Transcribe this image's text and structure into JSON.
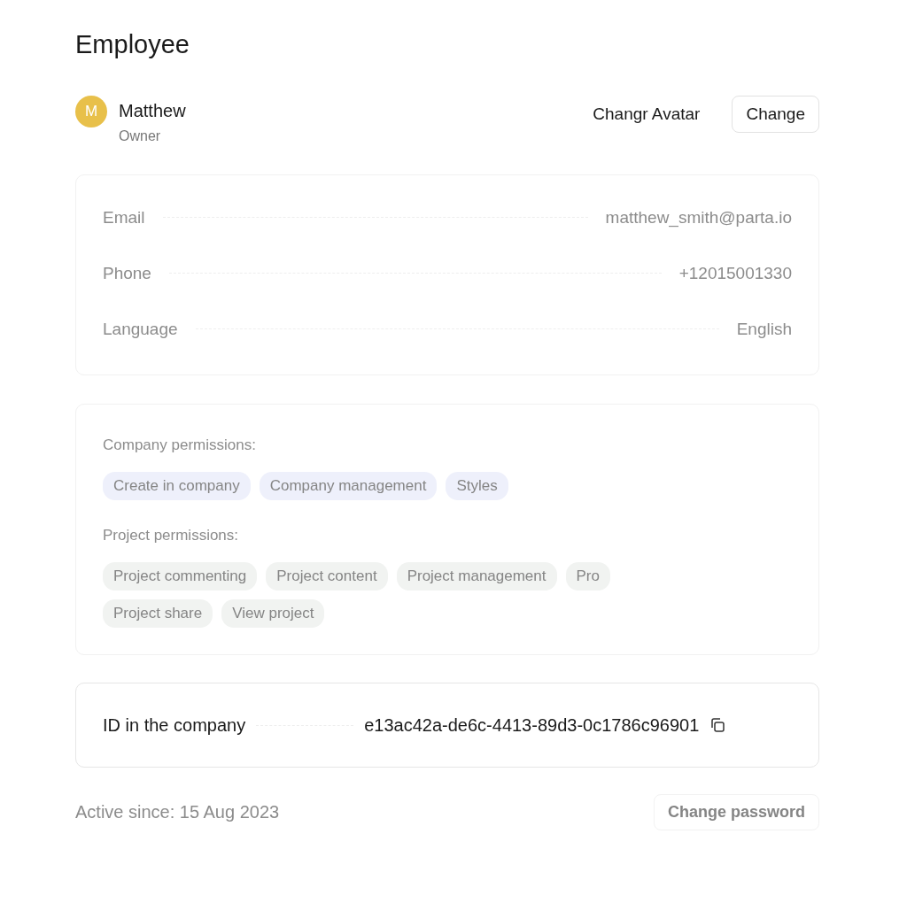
{
  "title": "Employee",
  "user": {
    "initial": "M",
    "name": "Matthew",
    "role": "Owner"
  },
  "avatar": {
    "label": "Changr Avatar",
    "button": "Change"
  },
  "contacts": [
    {
      "label": "Email",
      "value": "matthew_smith@parta.io"
    },
    {
      "label": "Phone",
      "value": "+12015001330"
    },
    {
      "label": "Language",
      "value": "English"
    }
  ],
  "permission_groups": [
    {
      "label": "Company permissions:",
      "color": "#eef0fb",
      "items": [
        "Create in company",
        "Company management",
        "Styles"
      ]
    },
    {
      "label": "Project permissions:",
      "color": "#f1f3f1",
      "items": [
        "Project commenting",
        "Project content",
        "Project management",
        "Pro",
        "Project share",
        "View project"
      ]
    }
  ],
  "id_field": {
    "label": "ID in the company",
    "value": "e13ac42a-de6c-4413-89d3-0c1786c96901"
  },
  "footer": {
    "active_since": "Active since: 15 Aug 2023",
    "button": "Change password"
  }
}
